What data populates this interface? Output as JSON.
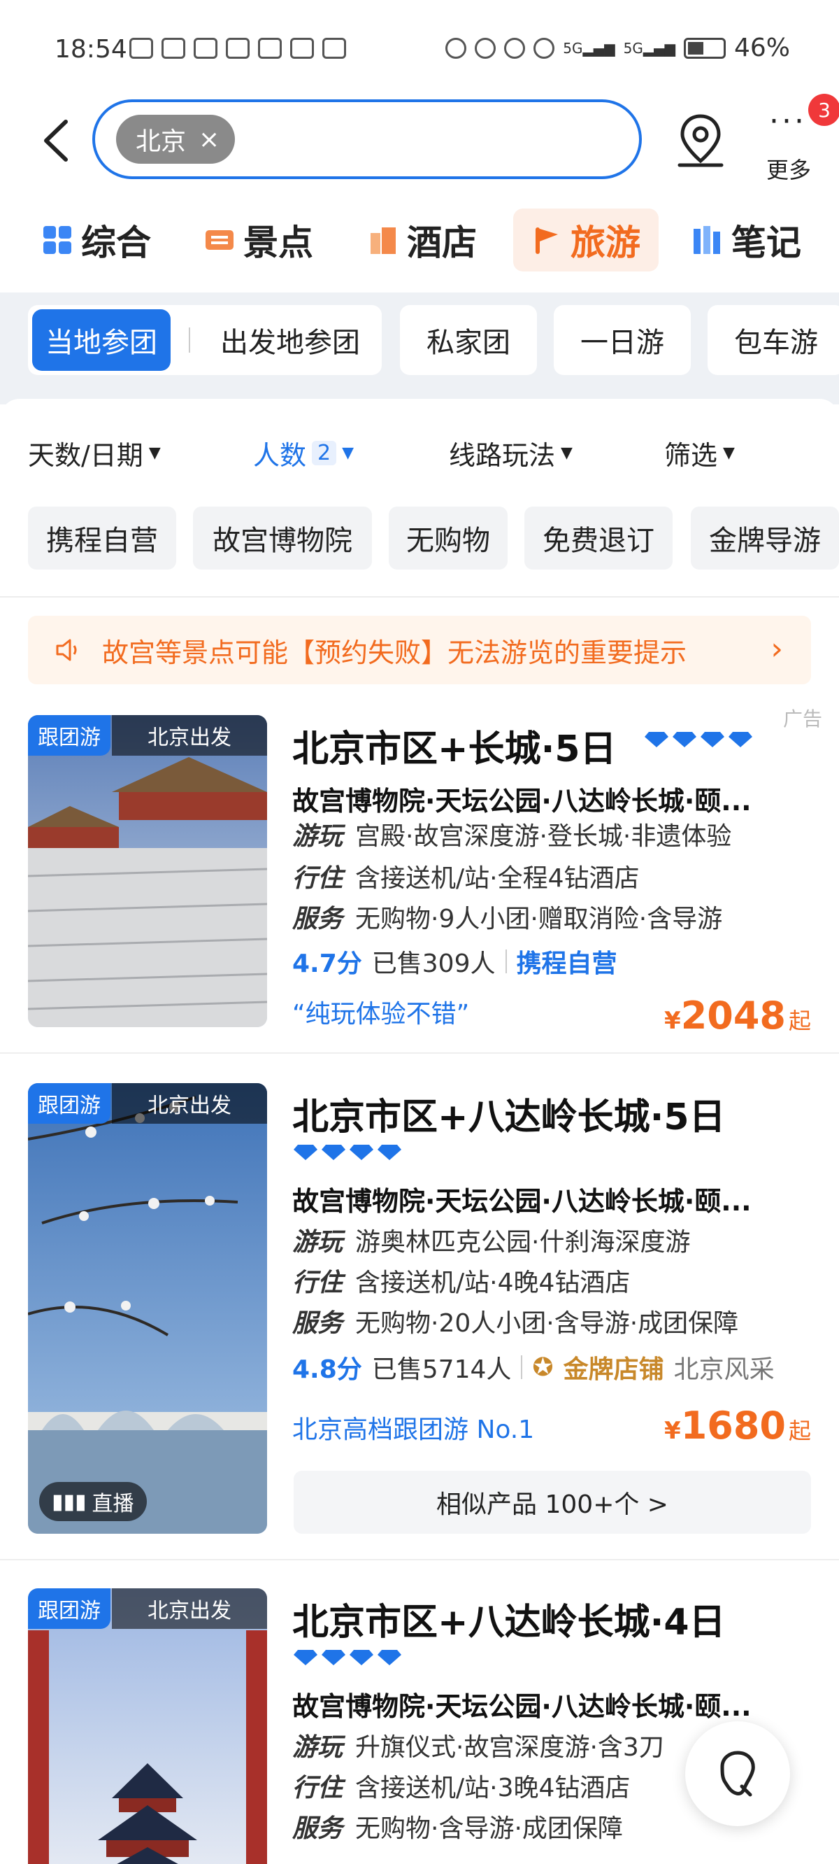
{
  "status_bar": {
    "time": "18:54",
    "battery": "46%"
  },
  "search": {
    "chip": "北京",
    "chip_close": "×"
  },
  "header": {
    "more_label": "更多",
    "more_badge": "3"
  },
  "category_tabs": [
    {
      "label": "综合",
      "icon": "grid-icon"
    },
    {
      "label": "景点",
      "icon": "ticket-icon"
    },
    {
      "label": "酒店",
      "icon": "hotel-icon"
    },
    {
      "label": "旅游",
      "icon": "flag-icon",
      "active": true
    },
    {
      "label": "笔记",
      "icon": "notes-icon"
    }
  ],
  "sub_tabs": [
    "当地参团",
    "出发地参团",
    "私家团",
    "一日游",
    "包车游"
  ],
  "filters": {
    "days": "天数/日期",
    "people": "人数",
    "people_count": "2",
    "route": "线路玩法",
    "screen": "筛选"
  },
  "quick_tags": [
    "携程自营",
    "故宫博物院",
    "无购物",
    "免费退订",
    "金牌导游"
  ],
  "notice": {
    "text": "故宫等景点可能【预约失败】无法游览的重要提示"
  },
  "ad_label": "广告",
  "products": [
    {
      "tag": "跟团游",
      "depart": "北京出发",
      "title": "北京市区+长城·5日",
      "diamonds": 4,
      "subtitle": "故宫博物院·天坛公园·八达岭长城·颐...",
      "play_k": "游玩",
      "play": "宫殿·故宫深度游·登长城·非遗体验",
      "stay_k": "行住",
      "stay": "含接送机/站·全程4钻酒店",
      "service_k": "服务",
      "service": "无购物·9人小团·赠取消险·含导游",
      "score": "4.7分",
      "sold": "已售309人",
      "badge": "携程自营",
      "quote": "“纯玩体验不错”",
      "currency": "¥",
      "price": "2048",
      "price_suffix": "起"
    },
    {
      "tag": "跟团游",
      "depart": "北京出发",
      "title": "北京市区+八达岭长城·5日",
      "diamonds": 4,
      "subtitle": "故宫博物院·天坛公园·八达岭长城·颐...",
      "play_k": "游玩",
      "play": "游奥林匹克公园·什刹海深度游",
      "stay_k": "行住",
      "stay": "含接送机/站·4晚4钻酒店",
      "service_k": "服务",
      "service": "无购物·20人小团·含导游·成团保障",
      "score": "4.8分",
      "sold": "已售5714人",
      "badge": "金牌店铺",
      "shop": "北京风采",
      "quote": "北京高档跟团游 No.1",
      "currency": "¥",
      "price": "1680",
      "price_suffix": "起",
      "live": "直播",
      "similar": "相似产品 100+个 >"
    },
    {
      "tag": "跟团游",
      "depart": "北京出发",
      "title": "北京市区+八达岭长城·4日",
      "diamonds": 4,
      "subtitle": "故宫博物院·天坛公园·八达岭长城·颐...",
      "play_k": "游玩",
      "play": "升旗仪式·故宫深度游·含3刀",
      "stay_k": "行住",
      "stay": "含接送机/站·3晚4钻酒店",
      "service_k": "服务",
      "service": "无购物·含导游·成团保障"
    }
  ],
  "colors": {
    "accent": "#1f74e8",
    "orange": "#f26b1f",
    "gold": "#c8882a"
  }
}
